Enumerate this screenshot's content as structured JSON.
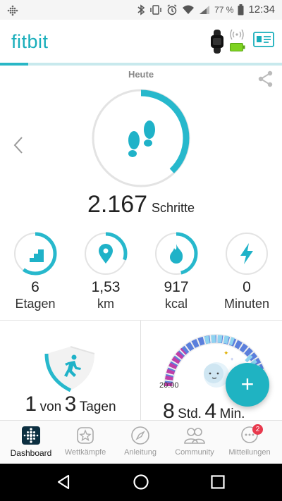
{
  "statusbar": {
    "battery": "77 %",
    "time": "12:34"
  },
  "app": {
    "logo": "fitbit",
    "colors": {
      "accent": "#29b7c6",
      "accent_light": "#c8e9ed",
      "battery": "#7ed321",
      "badge": "#e8394d"
    }
  },
  "dashboard": {
    "day_label": "Heute",
    "progress_fraction": 0.1,
    "steps": {
      "value": "2.167",
      "unit": "Schritte",
      "goal_fraction": 0.38
    },
    "stats": [
      {
        "id": "floors",
        "icon": "stairs-icon",
        "value": "6",
        "unit": "Etagen",
        "fraction": 0.6
      },
      {
        "id": "distance",
        "icon": "location-pin-icon",
        "value": "1,53",
        "unit": "km",
        "fraction": 0.3
      },
      {
        "id": "calories",
        "icon": "flame-icon",
        "value": "917",
        "unit": "kcal",
        "fraction": 0.46
      },
      {
        "id": "active",
        "icon": "lightning-icon",
        "value": "0",
        "unit": "Minuten",
        "fraction": 0
      }
    ],
    "challenge": {
      "num1": "1",
      "text1": "von",
      "num2": "3",
      "text2": "Tagen"
    },
    "sleep": {
      "bedtime": "20:00",
      "hours": "8",
      "hours_unit": "Std.",
      "minutes": "4",
      "minutes_unit": "Min."
    }
  },
  "fab": {
    "label": "+"
  },
  "bottomnav": [
    {
      "label": "Dashboard",
      "icon": "dashboard-icon",
      "active": true
    },
    {
      "label": "Wettkämpfe",
      "icon": "star-badge-icon",
      "active": false
    },
    {
      "label": "Anleitung",
      "icon": "compass-icon",
      "active": false
    },
    {
      "label": "Community",
      "icon": "people-icon",
      "active": false
    },
    {
      "label": "Mitteilungen",
      "icon": "chat-bubble-icon",
      "active": false,
      "badge": "2"
    }
  ]
}
